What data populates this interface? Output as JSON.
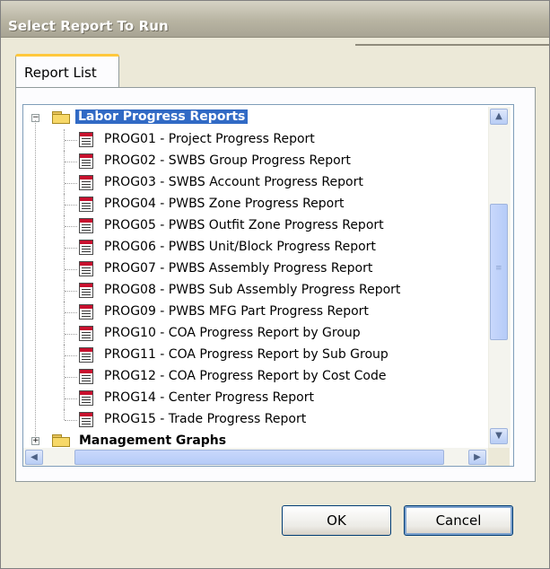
{
  "window": {
    "title": "Select Report To Run"
  },
  "tabs": [
    {
      "label": "Report List"
    }
  ],
  "tree": {
    "groups": [
      {
        "label": "Labor Progress Reports",
        "expanded": true,
        "expander_symbol": "−",
        "items": [
          "PROG01 - Project Progress Report",
          "PROG02 - SWBS Group Progress Report",
          "PROG03 - SWBS Account Progress Report",
          "PROG04 - PWBS Zone Progress Report",
          "PROG05 - PWBS Outfit Zone Progress Report",
          "PROG06 - PWBS Unit/Block Progress Report",
          "PROG07 - PWBS Assembly Progress Report",
          "PROG08 - PWBS Sub Assembly Progress Report",
          "PROG09 - PWBS MFG Part Progress Report",
          "PROG10 - COA Progress Report by Group",
          "PROG11 - COA Progress Report by Sub Group",
          "PROG12 - COA Progress Report by Cost Code",
          "PROG14 - Center Progress Report",
          "PROG15 - Trade Progress Report"
        ]
      },
      {
        "label": "Management Graphs",
        "expanded": false,
        "expander_symbol": "+"
      }
    ],
    "selected": "Labor Progress Reports"
  },
  "scrollbars": {
    "up": "▲",
    "down": "▼",
    "left": "◀",
    "right": "▶"
  },
  "buttons": {
    "ok": "OK",
    "cancel": "Cancel"
  },
  "colors": {
    "selection": "#316ac5",
    "titlebar": "#b8b4a2",
    "dialog": "#ece9d8"
  }
}
